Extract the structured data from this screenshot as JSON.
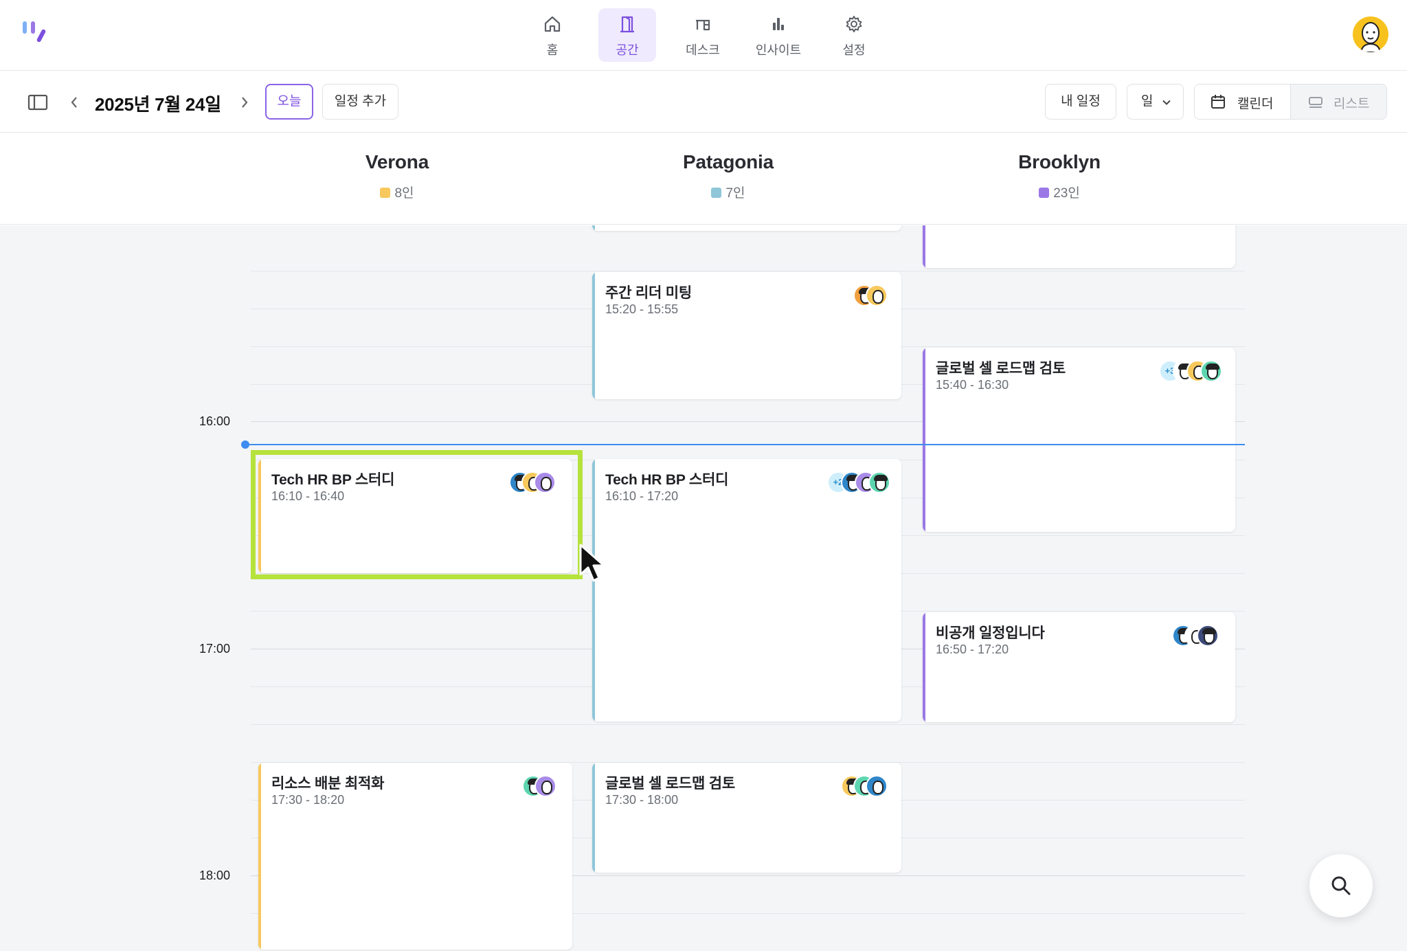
{
  "nav": {
    "items": [
      {
        "label": "홈",
        "icon": "home-icon"
      },
      {
        "label": "공간",
        "icon": "door-icon"
      },
      {
        "label": "데스크",
        "icon": "desk-icon"
      },
      {
        "label": "인사이트",
        "icon": "bar-chart-icon"
      },
      {
        "label": "설정",
        "icon": "gear-icon"
      }
    ],
    "active_index": 1,
    "accent": "#7c4fe0"
  },
  "toolbar": {
    "date": "2025년 7월 24일",
    "today_label": "오늘",
    "add_label": "일정 추가",
    "my_schedule_label": "내 일정",
    "view_select_value": "일",
    "calendar_label": "캘린더",
    "list_label": "리스트"
  },
  "rooms": [
    {
      "name": "Verona",
      "capacity": "8인",
      "color": "#f7c95c"
    },
    {
      "name": "Patagonia",
      "capacity": "7인",
      "color": "#8fc6d8"
    },
    {
      "name": "Brooklyn",
      "capacity": "23인",
      "color": "#9b78e6"
    }
  ],
  "time_labels": [
    "16:00",
    "17:00",
    "18:00"
  ],
  "events": [
    {
      "room": "Patagonia",
      "title": "주간 리더 미팅",
      "time": "15:20 - 15:55",
      "more": ""
    },
    {
      "room": "Brooklyn",
      "title": "글로벌 셀 로드맵 검토",
      "time": "15:40 - 16:30",
      "more": "+3"
    },
    {
      "room": "Verona",
      "title": "Tech HR BP 스터디",
      "time": "16:10 - 16:40",
      "more": ""
    },
    {
      "room": "Patagonia",
      "title": "Tech HR BP 스터디",
      "time": "16:10 - 17:20",
      "more": "+2"
    },
    {
      "room": "Brooklyn",
      "title": "비공개 일정입니다",
      "time": "16:50 - 17:20",
      "more": ""
    },
    {
      "room": "Verona",
      "title": "리소스 배분 최적화",
      "time": "17:30 - 18:20",
      "more": ""
    },
    {
      "room": "Patagonia",
      "title": "글로벌 셀 로드맵 검토",
      "time": "17:30 - 18:00",
      "more": ""
    }
  ],
  "colors": {
    "now_line": "#3d8cf0",
    "highlight": "#b6e23c"
  }
}
